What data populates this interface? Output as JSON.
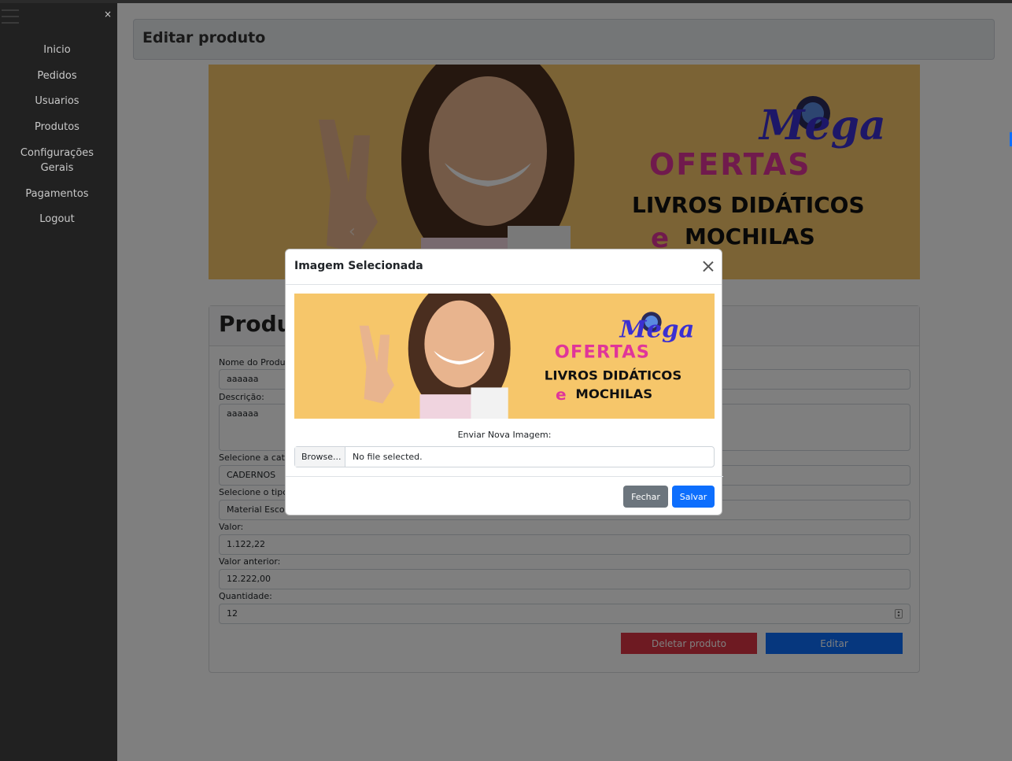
{
  "sidebar": {
    "close_label": "×",
    "items": [
      {
        "label": "Inicio"
      },
      {
        "label": "Pedidos"
      },
      {
        "label": "Usuarios"
      },
      {
        "label": "Produtos"
      },
      {
        "label": "Configurações Gerais"
      },
      {
        "label": "Pagamentos"
      },
      {
        "label": "Logout"
      }
    ]
  },
  "header": {
    "title": "Editar produto"
  },
  "banner": {
    "prev_icon": "‹",
    "next_icon": "›",
    "text_line1": "Mega",
    "text_line2": "OFERTAS",
    "text_line3": "LIVROS DIDÁTICOS",
    "text_line4_e": "e",
    "text_line4": "MOCHILAS"
  },
  "form": {
    "title": "Produt",
    "fields": [
      {
        "label": "Nome do Produ",
        "value": "aaaaaa"
      },
      {
        "label": "Descrição:",
        "value": "aaaaaa"
      },
      {
        "label": "Selecione a cat",
        "value": "CADERNOS"
      },
      {
        "label": "Selecione o tipo",
        "value": "Material Escol"
      },
      {
        "label": "Valor:",
        "value": "1.122,22"
      },
      {
        "label": "Valor anterior:",
        "value": "12.222,00"
      },
      {
        "label": "Quantidade:",
        "value": "12"
      }
    ],
    "delete_label": "Deletar produto",
    "edit_label": "Editar"
  },
  "modal": {
    "title": "Imagem Selecionada",
    "upload_label": "Enviar Nova Imagem:",
    "browse_label": "Browse...",
    "file_status": "No file selected.",
    "close_button": "Fechar",
    "save_button": "Salvar"
  },
  "colors": {
    "sidebar_bg": "#212121",
    "banner_bg": "#f6c66a",
    "primary": "#0d6efd",
    "danger": "#dc3545",
    "secondary": "#6c757d",
    "accent_pink": "#e0359a",
    "accent_purple": "#3b2fd1"
  }
}
